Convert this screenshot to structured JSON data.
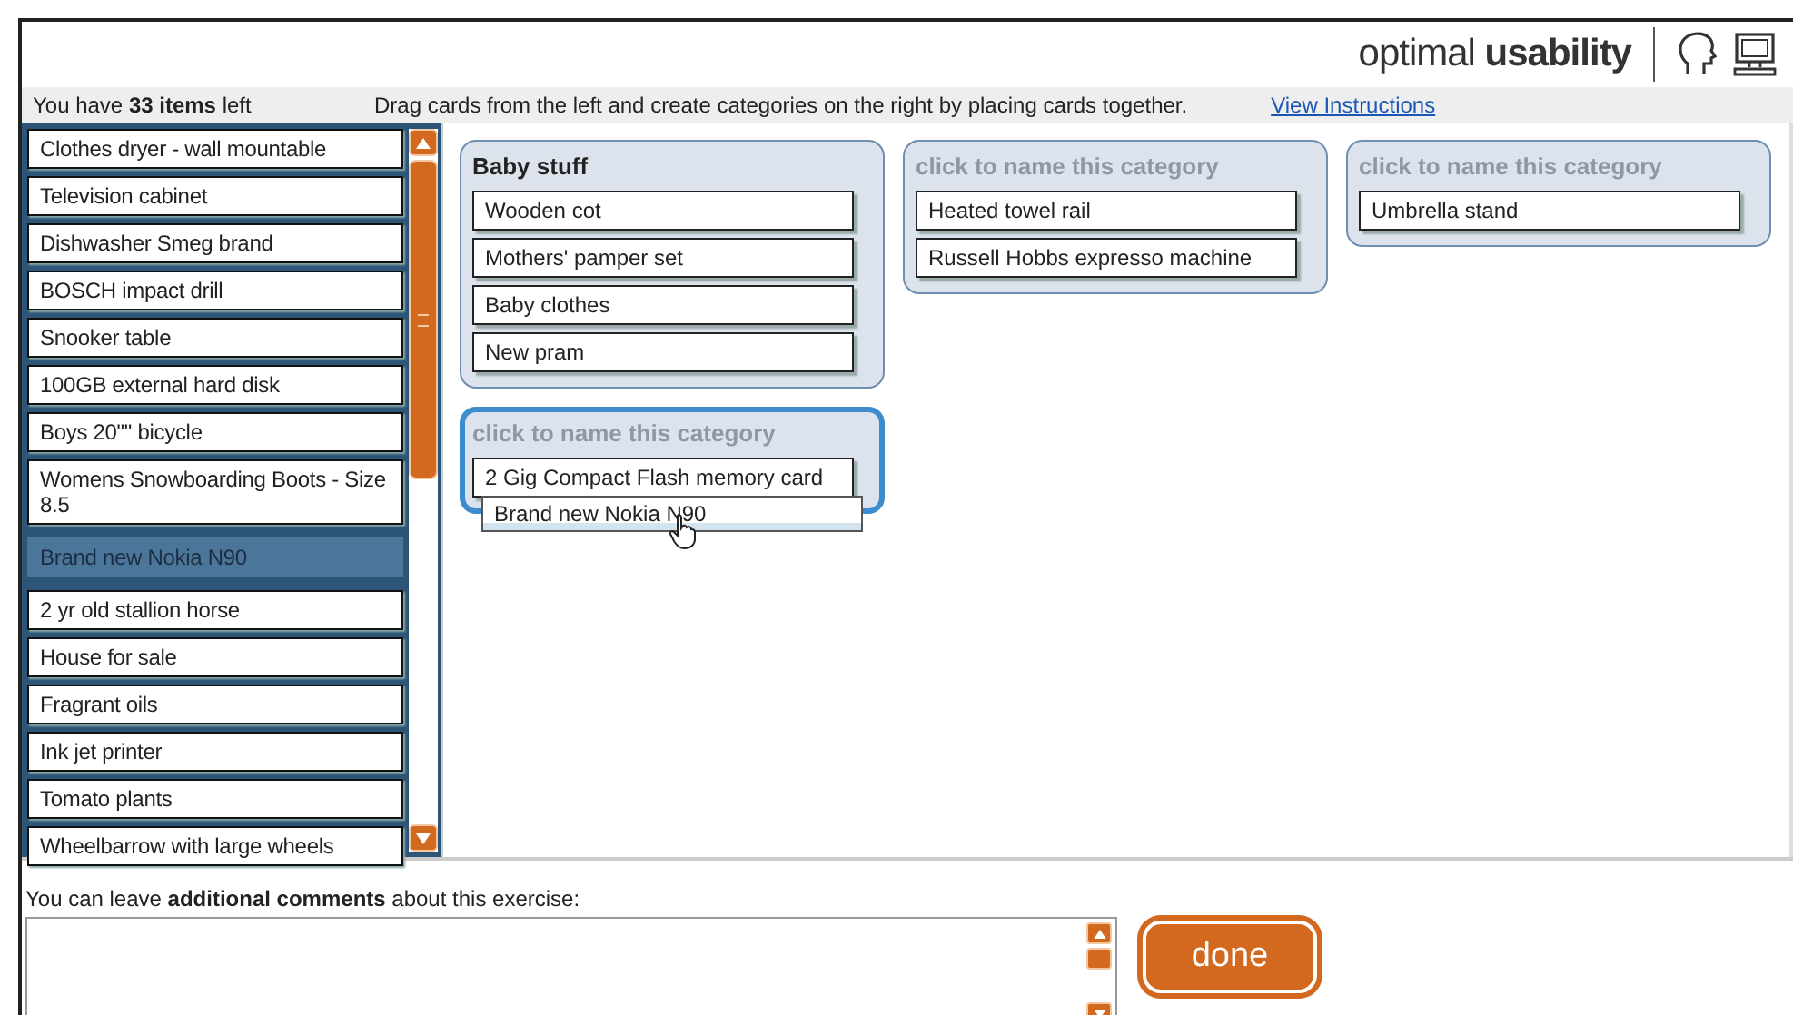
{
  "header": {
    "brand": "optimal **usability**"
  },
  "info_bar": {
    "items_left": "You have **33 items** left",
    "instructions": "Drag cards from the left and create categories on the right by placing cards together.",
    "link": "View Instructions"
  },
  "cards": [
    {
      "label": "Clothes dryer - wall mountable",
      "dragging": false
    },
    {
      "label": "Television cabinet",
      "dragging": false
    },
    {
      "label": "Dishwasher Smeg brand",
      "dragging": false
    },
    {
      "label": "BOSCH impact drill",
      "dragging": false
    },
    {
      "label": "Snooker table",
      "dragging": false
    },
    {
      "label": "100GB external hard disk",
      "dragging": false
    },
    {
      "label": "Boys 20\"\" bicycle",
      "dragging": false
    },
    {
      "label": "Womens Snowboarding Boots - Size 8.5",
      "dragging": false
    },
    {
      "label": "Brand new Nokia N90",
      "dragging": true
    },
    {
      "label": "2 yr old stallion horse",
      "dragging": false
    },
    {
      "label": "House for sale",
      "dragging": false
    },
    {
      "label": "Fragrant oils",
      "dragging": false
    },
    {
      "label": "Ink jet printer",
      "dragging": false
    },
    {
      "label": "Tomato plants",
      "dragging": false
    },
    {
      "label": "Wheelbarrow with large wheels",
      "dragging": false
    }
  ],
  "category_columns": [
    [
      {
        "name": "Baby stuff",
        "highlighted": false,
        "cards": [
          "Wooden cot",
          "Mothers' pamper set",
          "Baby clothes",
          "New pram"
        ]
      },
      {
        "placeholder": "click to name this category",
        "highlighted": true,
        "cards": [
          "2 Gig Compact Flash memory card"
        ]
      }
    ],
    [
      {
        "placeholder": "click to name this category",
        "highlighted": false,
        "cards": [
          "Heated towel rail",
          "Russell Hobbs expresso machine"
        ]
      }
    ],
    [
      {
        "placeholder": "click to name this category",
        "highlighted": false,
        "cards": [
          "Umbrella stand"
        ]
      }
    ]
  ],
  "dragged_card": "Brand new Nokia N90",
  "comments": {
    "label": "You can leave **additional comments** about this exercise:"
  },
  "done_button": "done"
}
